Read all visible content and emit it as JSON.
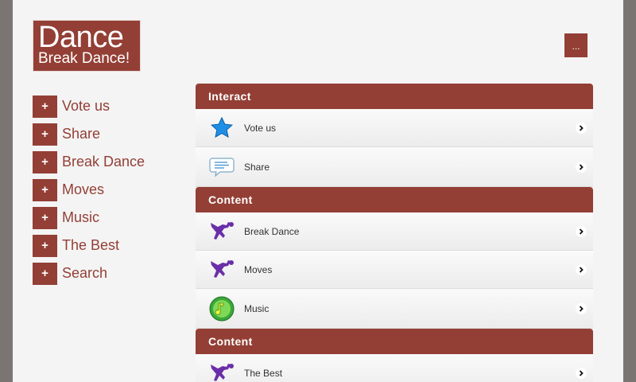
{
  "logo": {
    "title": "Dance",
    "subtitle": "Break Dance!"
  },
  "header": {
    "more_label": "..."
  },
  "sidebar": {
    "items": [
      {
        "plus": "+",
        "label": "Vote us"
      },
      {
        "plus": "+",
        "label": "Share"
      },
      {
        "plus": "+",
        "label": "Break Dance"
      },
      {
        "plus": "+",
        "label": "Moves"
      },
      {
        "plus": "+",
        "label": "Music"
      },
      {
        "plus": "+",
        "label": "The Best"
      },
      {
        "plus": "+",
        "label": "Search"
      }
    ]
  },
  "sections": [
    {
      "title": "Interact",
      "rows": [
        {
          "label": "Vote us",
          "icon": "star-icon"
        },
        {
          "label": "Share",
          "icon": "chat-bubble-icon"
        }
      ]
    },
    {
      "title": "Content",
      "rows": [
        {
          "label": "Break Dance",
          "icon": "dancer-icon"
        },
        {
          "label": "Moves",
          "icon": "dancer-icon"
        },
        {
          "label": "Music",
          "icon": "music-note-icon"
        }
      ]
    },
    {
      "title": "Content",
      "rows": [
        {
          "label": "The Best",
          "icon": "dancer-icon"
        }
      ]
    }
  ],
  "colors": {
    "accent": "#933f35",
    "background": "#f4f4f4",
    "outer": "#7a7573"
  }
}
